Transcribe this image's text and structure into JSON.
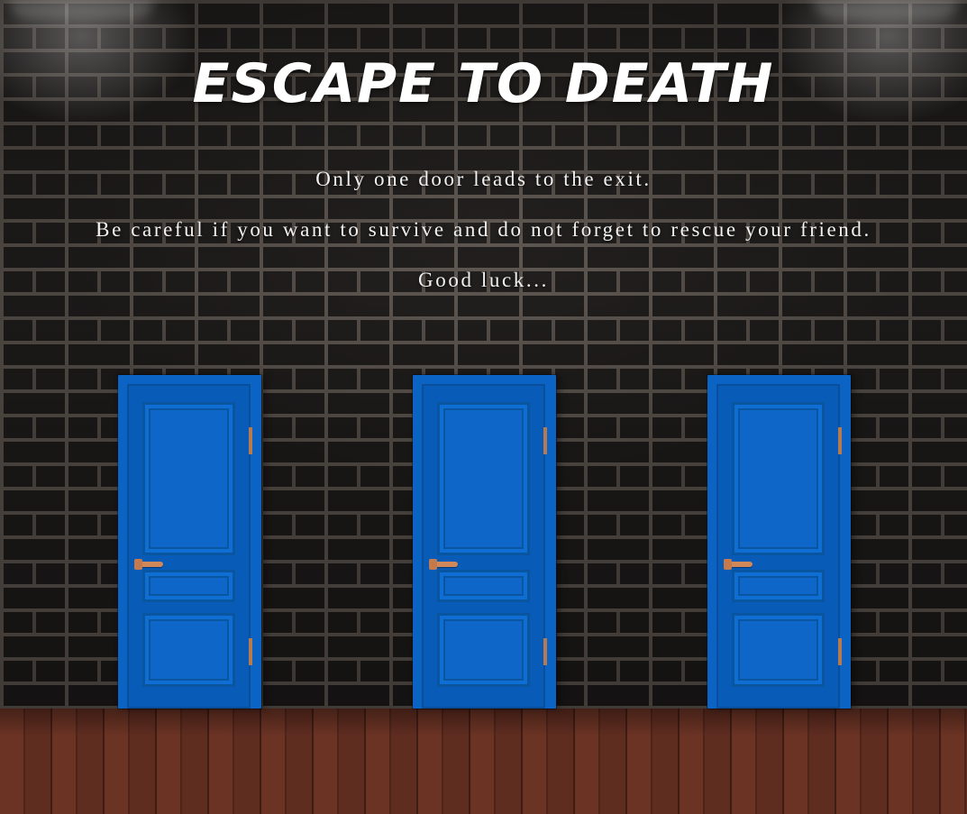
{
  "game": {
    "title": "ESCAPE TO DEATH",
    "intro_lines": [
      "Only one door leads to the exit.",
      "Be careful if you want to survive and do not forget to rescue your friend.",
      "Good luck..."
    ]
  },
  "doors": [
    {
      "name": "door-1",
      "color": "#0b64c4"
    },
    {
      "name": "door-2",
      "color": "#0b64c4"
    },
    {
      "name": "door-3",
      "color": "#0b64c4"
    }
  ],
  "colors": {
    "door_blue": "#0b64c4",
    "handle_copper": "#d0875a",
    "title_text": "#ffffff",
    "floor_wood": "#5a2a1e"
  }
}
